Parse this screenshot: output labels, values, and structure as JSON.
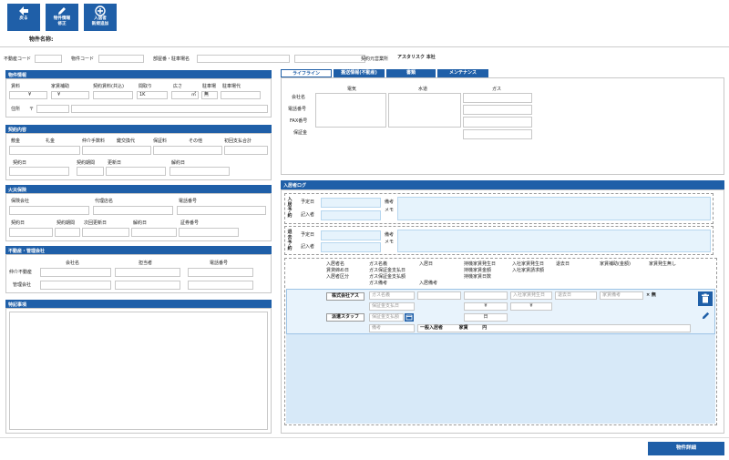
{
  "toolbar": {
    "back_label": "戻る",
    "edit_label": "物件情報\n修正",
    "add_label": "入居者\n新規追加"
  },
  "page": {
    "property_name_label": "物件名称:"
  },
  "search": {
    "realestate_code_label": "不動産コード",
    "property_code_label": "物件コード",
    "room_parking_label": "部屋番・駐車場名",
    "contract_office_label": "契約元営業所",
    "contract_office_value": "アスタリスク 本社"
  },
  "property_info": {
    "title": "物件情報",
    "rent_label": "賃料",
    "rent_subsidy_label": "家賃補助",
    "contract_rent_label": "契約賃料(共込)",
    "layout_label": "間取り",
    "area_label": "広さ",
    "parking_label": "駐車場",
    "parking_fee_label": "駐車場代",
    "yen1": "¥",
    "yen2": "¥",
    "layout_value": "1K",
    "area_unit": "㎡",
    "parking_value": "無",
    "address_label": "住所",
    "postal_mark": "〒"
  },
  "contract": {
    "title": "契約内容",
    "deposit_label": "敷金",
    "key_money_label": "礼金",
    "broker_fee_label": "仲介手数料",
    "key_exchange_label": "鍵交換代",
    "guarantee_fee_label": "保証料",
    "other_label": "その他",
    "initial_total_label": "初回支払合計",
    "contract_date_label": "契約日",
    "contract_period_label": "契約期間",
    "renewal_date_label": "更新日",
    "cancel_date_label": "解約日"
  },
  "fire_insurance": {
    "title": "火災保険",
    "company_label": "保険会社",
    "agency_label": "代理店名",
    "phone_label": "電話番号",
    "contract_date_label": "契約日",
    "period_label": "契約期間",
    "next_renewal_label": "次回更新日",
    "cancel_date_label": "解約日",
    "certificate_label": "証券番号"
  },
  "agency": {
    "title": "不動産・管理会社",
    "company_label": "会社名",
    "person_label": "担当者",
    "phone_label": "電話番号",
    "broker_label": "仲介不動産",
    "manager_label": "管理会社"
  },
  "notes": {
    "title": "特記事項"
  },
  "tabs": [
    {
      "label": "ライフライン"
    },
    {
      "label": "搬送情報(不動産)"
    },
    {
      "label": "書類"
    },
    {
      "label": "メンテナンス"
    }
  ],
  "lifeline": {
    "electric_label": "電気",
    "water_label": "水道",
    "gas_label": "ガス",
    "company_label": "会社名",
    "phone_label": "電話番号",
    "fax_label": "FAX番号",
    "deposit_label": "保証金"
  },
  "tenant_log": {
    "title": "入居者ログ",
    "move_in_tag": "入居予約",
    "move_out_tag": "退去予約",
    "scheduled_label": "予定日",
    "recorder_label": "記入者",
    "remarks_label": "備考",
    "memo_label": "メモ"
  },
  "tenant_table": {
    "headers": [
      "入居者名",
      "賃貸締め日",
      "入居日",
      "入居者区分",
      "ガス名義",
      "ガス保証金支払日",
      "ガス保証金支払額",
      "ガス備考",
      "入居日",
      "入居備考",
      "持機家賃発生日",
      "持機家賃金額",
      "持機家賃日数",
      "入社家賃発生日",
      "入社家賃請求額",
      "退去日",
      "家賃補助(金額)",
      "家賃発生無し"
    ],
    "row": {
      "company": "株式会社アス",
      "staff": "派遣スタッフ",
      "gas_name_placeholder": "ガス名義",
      "gas_deposit_date_placeholder": "保証金支払日",
      "gas_deposit_amount_placeholder": "保証金支払額",
      "remarks_placeholder": "備考",
      "yen_a": "¥",
      "yen_b": "¥",
      "day_unit": "日",
      "company_rent_date_placeholder": "入社家賃発生日",
      "move_out_placeholder": "退去日",
      "rent_remark_placeholder": "家賃備考",
      "no_rent_mark": "× 無",
      "tenant_type": "一般入居者",
      "rent_amount": "家賃",
      "yen_unit": "円"
    }
  },
  "footer": {
    "detail_button": "物件詳細"
  },
  "colors": {
    "primary": "#1f5fa8",
    "light_blue": "#e6f3fc",
    "row_blue": "#d7e9f8"
  }
}
